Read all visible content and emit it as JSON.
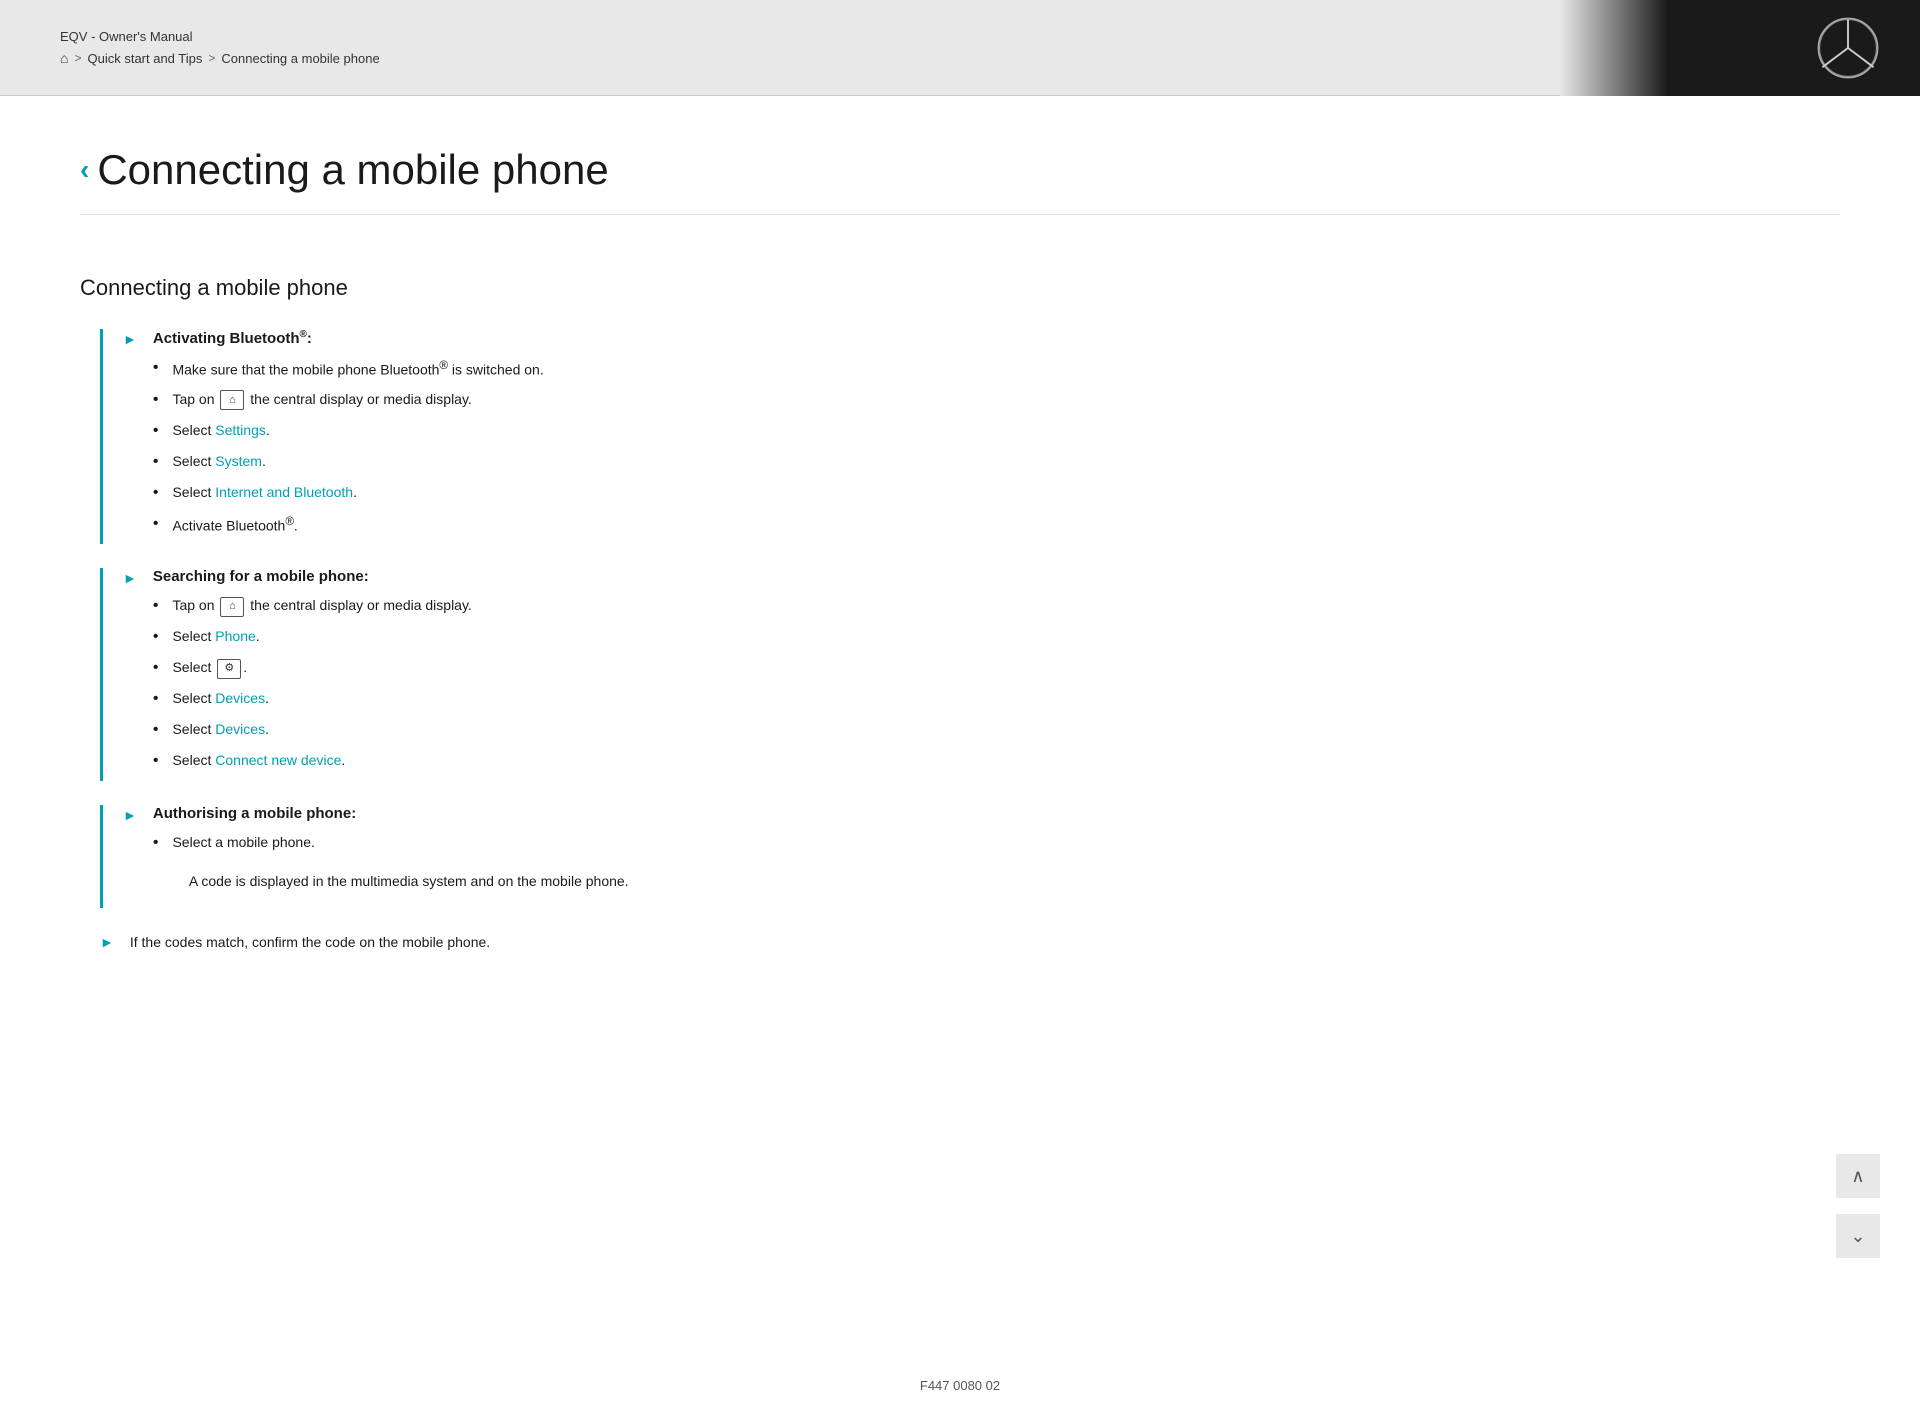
{
  "header": {
    "manual_title": "EQV - Owner's Manual",
    "breadcrumb": {
      "home_icon": "⌂",
      "sep1": ">",
      "link1": "Quick start and Tips",
      "sep2": ">",
      "link2": "Connecting a mobile phone"
    }
  },
  "logo": {
    "alt": "Mercedes-Benz Logo"
  },
  "page": {
    "back_chevron": "‹",
    "title": "Connecting a mobile phone",
    "section_heading": "Connecting a mobile phone"
  },
  "steps": [
    {
      "id": "step1",
      "arrow": "►",
      "title": "Activating Bluetooth",
      "title_sup": "®",
      "title_suffix": ":",
      "bullets": [
        {
          "text": "Make sure that the mobile phone Bluetooth® is switched on.",
          "has_link": false
        },
        {
          "text_before": "Tap on",
          "icon": "home",
          "text_after": "the central display or media display.",
          "has_icon": true
        },
        {
          "text_before": "Select ",
          "link": "Settings",
          "text_after": ".",
          "has_link": true
        },
        {
          "text_before": "Select ",
          "link": "System",
          "text_after": ".",
          "has_link": true
        },
        {
          "text_before": "Select ",
          "link": "Internet and Bluetooth",
          "text_after": ".",
          "has_link": true
        },
        {
          "text": "Activate Bluetooth®.",
          "has_link": false
        }
      ]
    },
    {
      "id": "step2",
      "arrow": "►",
      "title": "Searching for a mobile phone:",
      "title_sup": "",
      "title_suffix": "",
      "bullets": [
        {
          "text_before": "Tap on",
          "icon": "home",
          "text_after": "the central display or media display.",
          "has_icon": true
        },
        {
          "text_before": "Select ",
          "link": "Phone",
          "text_after": ".",
          "has_link": true
        },
        {
          "text_before": "Select ",
          "icon": "gear",
          "text_after": ".",
          "has_icon_only": true
        },
        {
          "text_before": "Select ",
          "link": "Devices",
          "text_after": ".",
          "has_link": true
        },
        {
          "text_before": "Select ",
          "link": "Devices",
          "text_after": ".",
          "has_link": true
        },
        {
          "text_before": "Select ",
          "link": "Connect new device",
          "text_after": ".",
          "has_link": true
        }
      ]
    },
    {
      "id": "step3",
      "arrow": "►",
      "title": "Authorising a mobile phone:",
      "title_sup": "",
      "title_suffix": "",
      "bullets": [
        {
          "text": "Select a mobile phone.",
          "has_link": false
        }
      ],
      "note": "A code is displayed in the multimedia system and on the mobile phone."
    },
    {
      "id": "step4",
      "arrow": "►",
      "title_plain": "If the codes match, confirm the code on the mobile phone.",
      "is_plain": true
    }
  ],
  "footer": {
    "code": "F447 0080 02"
  },
  "buttons": {
    "scroll_up": "∧",
    "scroll_down": "⌄"
  }
}
